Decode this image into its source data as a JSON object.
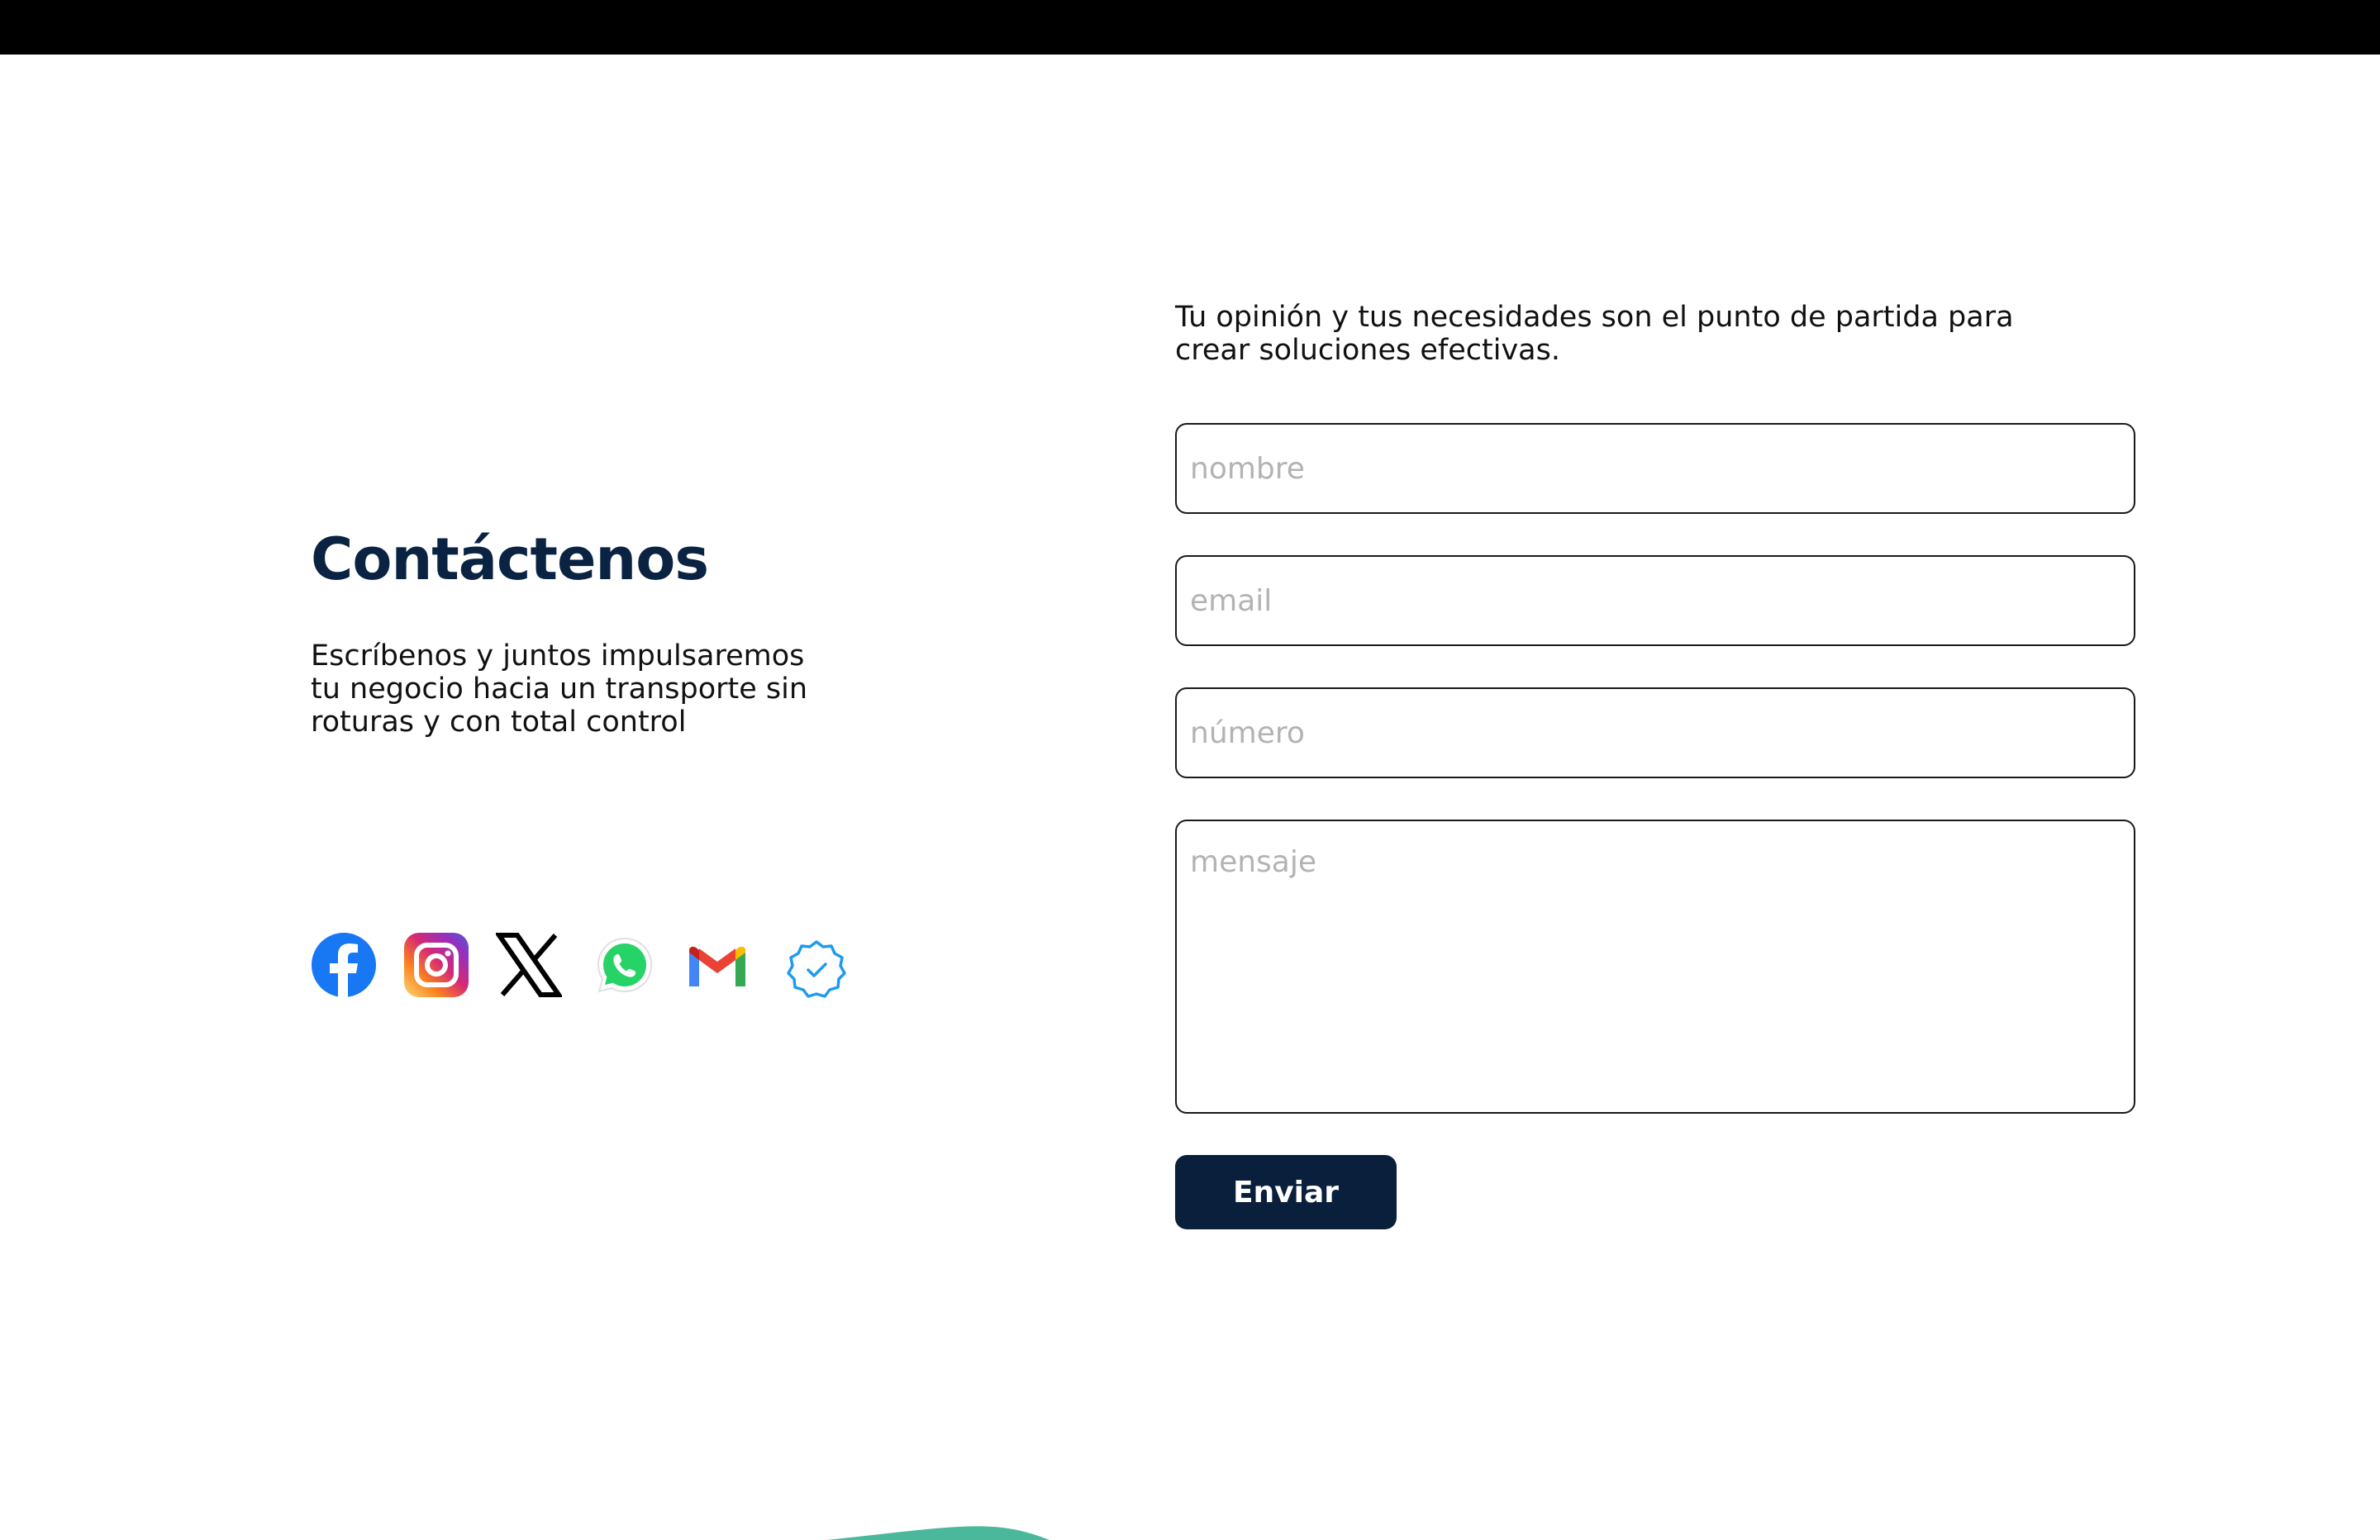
{
  "contact": {
    "title": "Contáctenos",
    "description": "Escríbenos y juntos impulsaremos tu negocio hacia un transporte sin roturas y con total control"
  },
  "socials": [
    {
      "name": "facebook-icon"
    },
    {
      "name": "instagram-icon"
    },
    {
      "name": "x-icon"
    },
    {
      "name": "whatsapp-icon"
    },
    {
      "name": "gmail-icon"
    },
    {
      "name": "verified-badge-icon"
    }
  ],
  "form": {
    "tagline": "Tu opinión y tus necesidades son el punto de partida para crear soluciones efectivas.",
    "name_placeholder": "nombre",
    "email_placeholder": "email",
    "number_placeholder": "número",
    "message_placeholder": "mensaje",
    "submit_label": "Enviar"
  },
  "colors": {
    "heading": "#0a2342",
    "button": "#0a1f3b",
    "accent_green": "#4bb89b"
  }
}
